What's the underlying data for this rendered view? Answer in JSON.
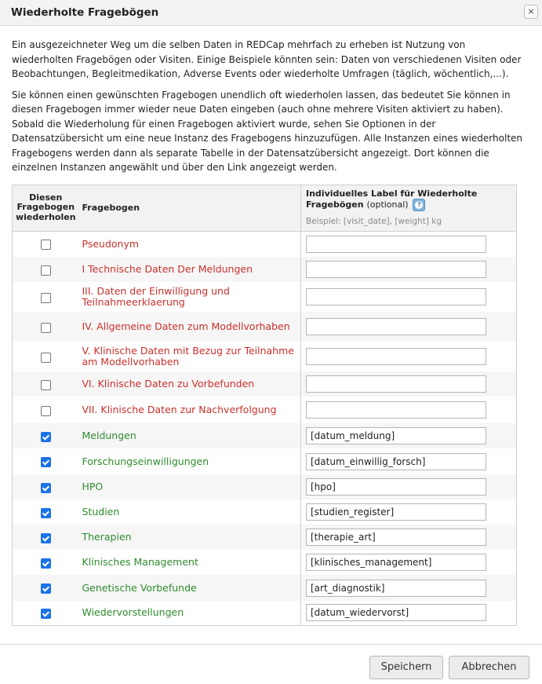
{
  "dialog": {
    "title": "Wiederholte Fragebögen",
    "close_label": "×"
  },
  "intro": {
    "paragraph1": "Ein ausgezeichneter Weg um die selben Daten in REDCap mehrfach zu erheben ist Nutzung von wiederholten Fragebögen oder Visiten. Einige Beispiele könnten sein: Daten von verschiedenen Visiten oder Beobachtungen, Begleitmedikation, Adverse Events oder wiederholte Umfragen (täglich, wöchentlich,...).",
    "paragraph2": "Sie können einen gewünschten Fragebogen unendlich oft wiederholen lassen, das bedeutet Sie können in diesen Fragebogen immer wieder neue Daten eingeben (auch ohne mehrere Visiten aktiviert zu haben). Sobald die Wiederholung für einen Fragebogen aktiviert wurde, sehen Sie Optionen in der Datensatzübersicht um eine neue Instanz des Fragebogens hinzuzufügen. Alle Instanzen eines wiederholten Fragebogens werden dann als separate Tabelle in der Datensatzübersicht angezeigt. Dort können die einzelnen Instanzen angewählt und über den Link angezeigt werden."
  },
  "table": {
    "col_repeat": "Diesen Fragebogen wiederholen",
    "col_form": "Fragebogen",
    "col_label": "Individuelles Label für Wiederholte Fragebögen",
    "col_label_optional": "(optional)",
    "col_label_example": "Beispiel: [visit_date], [weight] kg",
    "help_icon_text": "?",
    "rows": [
      {
        "form": "Pseudonym",
        "checked": false,
        "label": ""
      },
      {
        "form": "I Technische Daten Der Meldungen",
        "checked": false,
        "label": ""
      },
      {
        "form": "III. Daten der Einwilligung und Teilnahmeerklaerung",
        "checked": false,
        "label": ""
      },
      {
        "form": "IV. Allgemeine Daten zum Modellvorhaben",
        "checked": false,
        "label": ""
      },
      {
        "form": "V. Klinische Daten mit Bezug zur Teilnahme am Modellvorhaben",
        "checked": false,
        "label": ""
      },
      {
        "form": "VI. Klinische Daten zu Vorbefunden",
        "checked": false,
        "label": ""
      },
      {
        "form": "VII. Klinische Daten zur Nachverfolgung",
        "checked": false,
        "label": ""
      },
      {
        "form": "Meldungen",
        "checked": true,
        "label": "[datum_meldung]"
      },
      {
        "form": "Forschungseinwilligungen",
        "checked": true,
        "label": "[datum_einwillig_forsch]"
      },
      {
        "form": "HPO",
        "checked": true,
        "label": "[hpo]"
      },
      {
        "form": "Studien",
        "checked": true,
        "label": "[studien_register]"
      },
      {
        "form": "Therapien",
        "checked": true,
        "label": "[therapie_art]"
      },
      {
        "form": "Klinisches Management",
        "checked": true,
        "label": "[klinisches_management]"
      },
      {
        "form": "Genetische Vorbefunde",
        "checked": true,
        "label": "[art_diagnostik]"
      },
      {
        "form": "Wiedervorstellungen",
        "checked": true,
        "label": "[datum_wiedervorst]"
      }
    ]
  },
  "footer": {
    "save_label": "Speichern",
    "cancel_label": "Abbrechen"
  },
  "colors": {
    "unchecked_form": "#c9302c",
    "checked_form": "#2e8b2e",
    "checkbox_checked": "#1a73e8"
  }
}
